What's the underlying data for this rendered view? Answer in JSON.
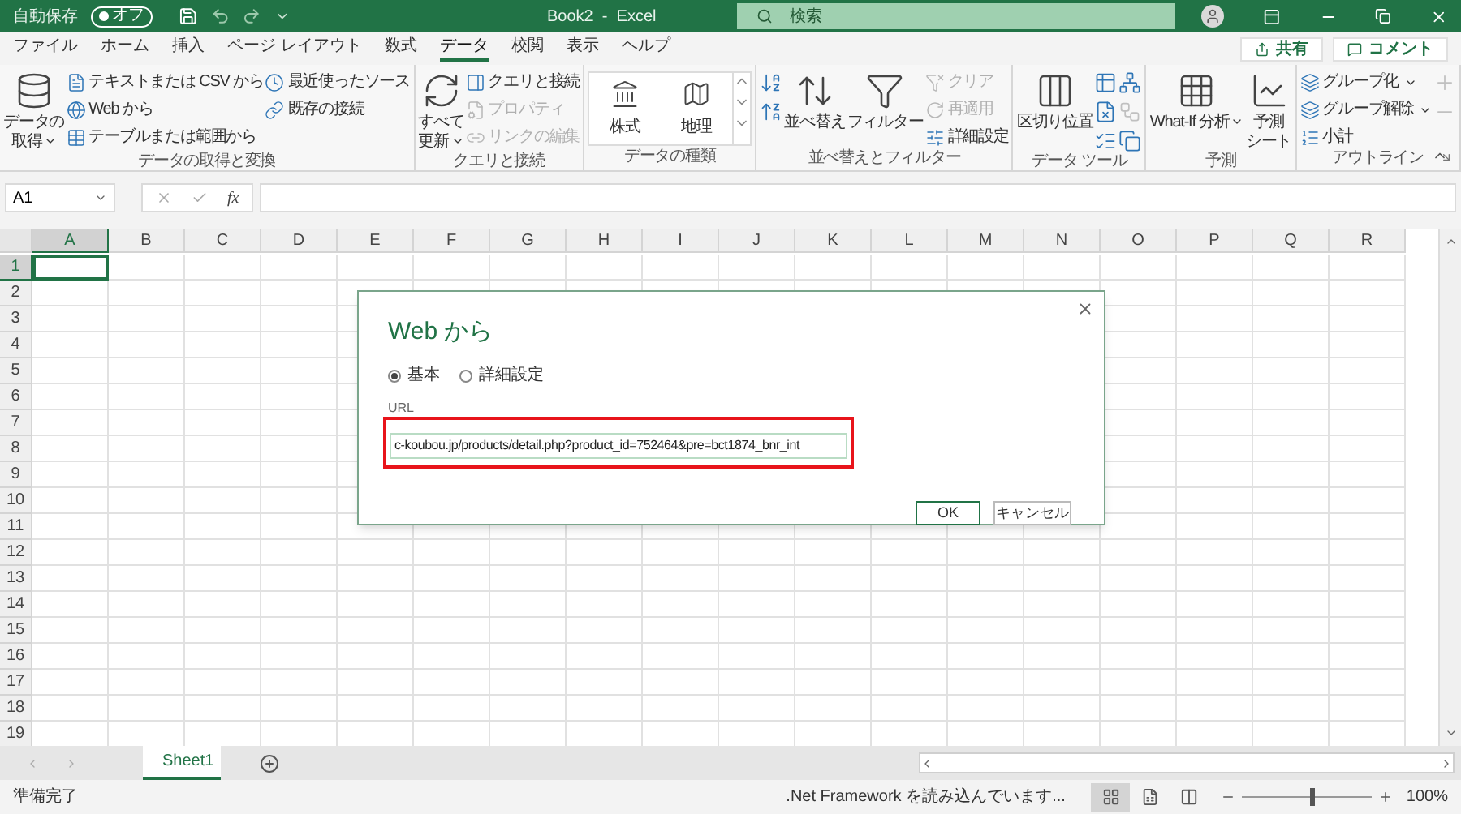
{
  "title_bar": {
    "autosave_label": "自動保存",
    "autosave": {
      "label": "オフ",
      "on": false
    },
    "title": "Book2  -  Excel",
    "search": {
      "placeholder": "検索"
    }
  },
  "menu_tabs": [
    {
      "label": "ファイル",
      "selected": false
    },
    {
      "label": "ホーム",
      "selected": false
    },
    {
      "label": "挿入",
      "selected": false
    },
    {
      "label": "ページ レイアウト",
      "selected": false
    },
    {
      "label": "数式",
      "selected": false
    },
    {
      "label": "データ",
      "selected": true
    },
    {
      "label": "校閲",
      "selected": false
    },
    {
      "label": "表示",
      "selected": false
    },
    {
      "label": "ヘルプ",
      "selected": false
    }
  ],
  "share_button": "共有",
  "comment_button": "コメント",
  "ribbon": [
    {
      "label": "データの取得と変換",
      "items": [
        {
          "kind": "large",
          "lines": [
            "データの",
            "取得"
          ],
          "dropdown": true
        },
        {
          "kind": "stack",
          "entries": [
            {
              "label": "テキストまたは CSV から",
              "disabled": false
            },
            {
              "label": "Web から",
              "disabled": false
            },
            {
              "label": "テーブルまたは範囲から",
              "disabled": false
            }
          ]
        },
        {
          "kind": "stack",
          "entries": [
            {
              "label": "最近使ったソース",
              "disabled": false
            },
            {
              "label": "既存の接続",
              "disabled": false
            }
          ]
        }
      ]
    },
    {
      "label": "クエリと接続",
      "items": [
        {
          "kind": "large",
          "lines": [
            "すべて",
            "更新"
          ],
          "dropdown": true
        },
        {
          "kind": "stack",
          "entries": [
            {
              "label": "クエリと接続",
              "disabled": false
            },
            {
              "label": "プロパティ",
              "disabled": true
            },
            {
              "label": "リンクの編集",
              "disabled": true
            }
          ]
        }
      ]
    },
    {
      "label": "データの種類",
      "items": [
        {
          "kind": "gallery",
          "entries": [
            "株式",
            "地理"
          ]
        }
      ]
    },
    {
      "label": "並べ替えとフィルター",
      "items": [
        {
          "kind": "icon_stack",
          "entries": [
            {
              "disabled": false
            },
            {
              "disabled": false
            }
          ]
        },
        {
          "kind": "large",
          "lines": [
            "並べ替え"
          ],
          "dropdown": false
        },
        {
          "kind": "large",
          "lines": [
            "フィルター"
          ],
          "dropdown": false
        },
        {
          "kind": "stack",
          "entries": [
            {
              "label": "クリア",
              "disabled": true
            },
            {
              "label": "再適用",
              "disabled": true
            },
            {
              "label": "詳細設定",
              "disabled": false
            }
          ]
        }
      ]
    },
    {
      "label": "データ ツール",
      "items": [
        {
          "kind": "large",
          "lines": [
            "区切り位置"
          ],
          "dropdown": false
        },
        {
          "kind": "icon_stack",
          "entries": [
            {
              "disabled": false
            },
            {
              "disabled": false
            },
            {
              "disabled": false
            }
          ]
        },
        {
          "kind": "icon_stack",
          "entries": [
            {
              "disabled": false
            },
            {
              "disabled": true
            },
            {
              "disabled": false
            }
          ]
        }
      ]
    },
    {
      "label": "予測",
      "items": [
        {
          "kind": "large",
          "lines": [
            "What-If 分析"
          ],
          "dropdown": true
        },
        {
          "kind": "large",
          "lines": [
            "予測",
            "シート"
          ],
          "dropdown": false
        }
      ]
    },
    {
      "label": "アウトライン",
      "launcher": true,
      "items": [
        {
          "kind": "stack",
          "entries": [
            {
              "label": "グループ化",
              "disabled": false,
              "dropdown": true
            },
            {
              "label": "グループ解除",
              "disabled": false,
              "dropdown": true
            },
            {
              "label": "小計",
              "disabled": false
            }
          ]
        },
        {
          "kind": "icon_stack",
          "entries": [
            {
              "disabled": true
            },
            {
              "disabled": true
            }
          ]
        }
      ]
    }
  ],
  "formula_bar": {
    "name_box": "A1",
    "function_label": "fx"
  },
  "sheet": {
    "columns": [
      {
        "label": "A",
        "selected": true
      },
      {
        "label": "B",
        "selected": false
      },
      {
        "label": "C",
        "selected": false
      },
      {
        "label": "D",
        "selected": false
      },
      {
        "label": "E",
        "selected": false
      },
      {
        "label": "F",
        "selected": false
      },
      {
        "label": "G",
        "selected": false
      },
      {
        "label": "H",
        "selected": false
      },
      {
        "label": "I",
        "selected": false
      },
      {
        "label": "J",
        "selected": false
      },
      {
        "label": "K",
        "selected": false
      },
      {
        "label": "L",
        "selected": false
      },
      {
        "label": "M",
        "selected": false
      },
      {
        "label": "N",
        "selected": false
      },
      {
        "label": "O",
        "selected": false
      },
      {
        "label": "P",
        "selected": false
      },
      {
        "label": "Q",
        "selected": false
      },
      {
        "label": "R",
        "selected": false
      }
    ],
    "rows": [
      {
        "label": "1",
        "selected": true
      },
      {
        "label": "2",
        "selected": false
      },
      {
        "label": "3",
        "selected": false
      },
      {
        "label": "4",
        "selected": false
      },
      {
        "label": "5",
        "selected": false
      },
      {
        "label": "6",
        "selected": false
      },
      {
        "label": "7",
        "selected": false
      },
      {
        "label": "8",
        "selected": false
      },
      {
        "label": "9",
        "selected": false
      },
      {
        "label": "10",
        "selected": false
      },
      {
        "label": "11",
        "selected": false
      },
      {
        "label": "12",
        "selected": false
      },
      {
        "label": "13",
        "selected": false
      },
      {
        "label": "14",
        "selected": false
      },
      {
        "label": "15",
        "selected": false
      },
      {
        "label": "16",
        "selected": false
      },
      {
        "label": "17",
        "selected": false
      },
      {
        "label": "18",
        "selected": false
      },
      {
        "label": "19",
        "selected": false
      }
    ]
  },
  "dialog": {
    "title": "Web から",
    "modes": [
      {
        "label": "基本",
        "selected": true
      },
      {
        "label": "詳細設定",
        "selected": false
      }
    ],
    "url_label": "URL",
    "url_value": "c-koubou.jp/products/detail.php?product_id=752464&pre=bct1874_bnr_int",
    "highlighted": true,
    "ok_button": "OK",
    "cancel_button": "キャンセル"
  },
  "sheet_tabs": [
    {
      "label": "Sheet1",
      "selected": true
    }
  ],
  "status_bar": {
    "status": "準備完了",
    "message": ".Net Framework を読み込んでいます...",
    "views": [
      {
        "selected": true
      },
      {
        "selected": false
      },
      {
        "selected": false
      }
    ],
    "zoom": {
      "level": 0.52,
      "label": "100%"
    }
  }
}
